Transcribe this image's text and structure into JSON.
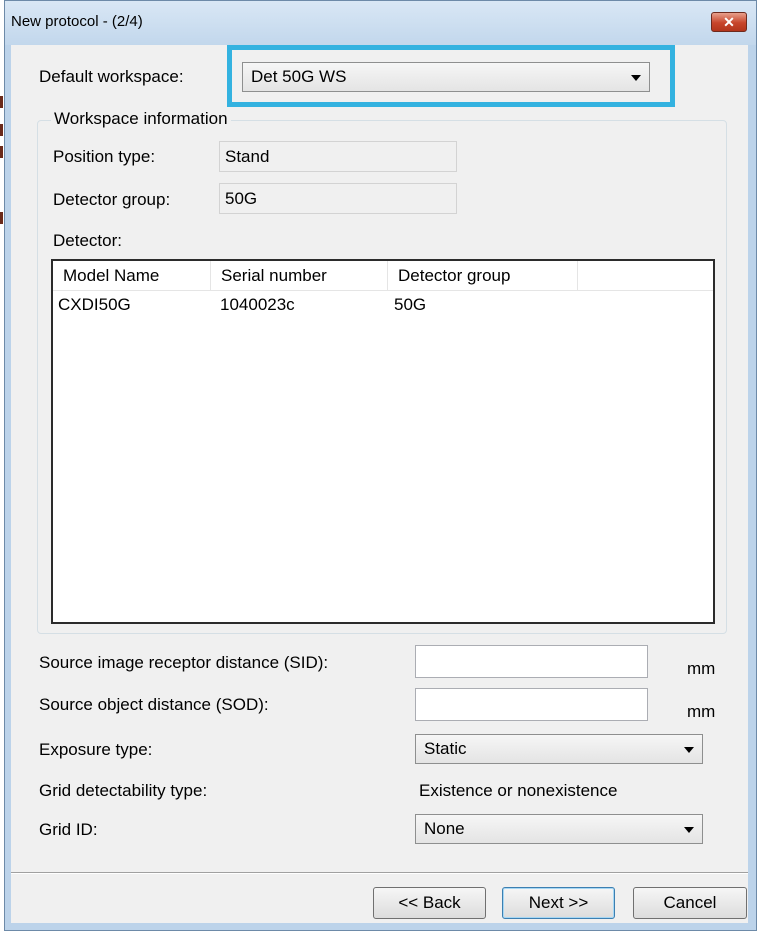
{
  "window": {
    "title": "New protocol - (2/4)",
    "close_glyph": "✕"
  },
  "workspace": {
    "label": "Default workspace:",
    "selected": "Det 50G WS"
  },
  "info": {
    "title": "Workspace information",
    "position_type_label": "Position type:",
    "position_type_value": "Stand",
    "detector_group_label": "Detector group:",
    "detector_group_value": "50G",
    "detector_label": "Detector:"
  },
  "detectors": {
    "columns": [
      "Model Name",
      "Serial number",
      "Detector group"
    ],
    "rows": [
      [
        "CXDI50G",
        "1040023c",
        "50G"
      ]
    ]
  },
  "fields": {
    "sid_label": "Source image receptor distance (SID):",
    "sid_value": "",
    "sid_unit": "mm",
    "sod_label": "Source object distance (SOD):",
    "sod_value": "",
    "sod_unit": "mm",
    "exposure_label": "Exposure type:",
    "exposure_value": "Static",
    "grid_detect_label": "Grid detectability type:",
    "grid_detect_value": "Existence or nonexistence",
    "grid_id_label": "Grid ID:",
    "grid_id_value": "None"
  },
  "buttons": {
    "back": "<< Back",
    "next": "Next >>",
    "cancel": "Cancel"
  },
  "colors": {
    "highlight": "#33b2e0",
    "titlebar": "#bcd3ea",
    "close": "#c7452b"
  }
}
